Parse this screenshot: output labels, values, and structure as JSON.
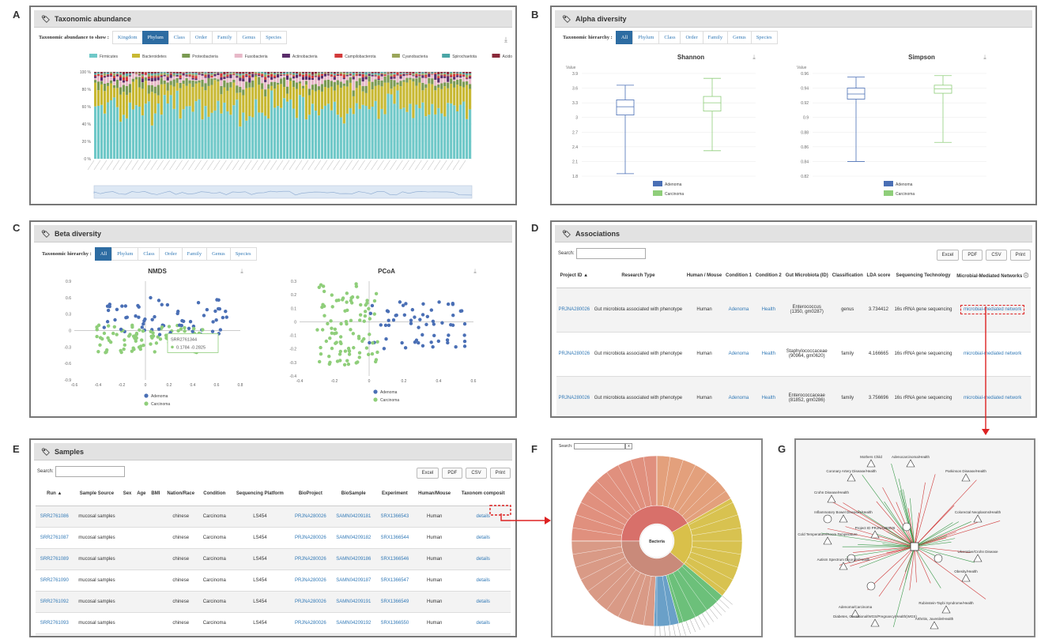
{
  "letters": [
    "A",
    "B",
    "C",
    "D",
    "E",
    "F",
    "G"
  ],
  "panelA": {
    "title": "Taxonomic abundance",
    "label": "Taxonomic abundance to show :",
    "tabs": [
      "Kingdom",
      "Phylum",
      "Class",
      "Order",
      "Family",
      "Genus",
      "Species"
    ],
    "legend": [
      "Firmicutes",
      "Bacteroidetes",
      "Proteobacteria",
      "Fusobacteria",
      "Actinobacteria",
      "Campilobacterota",
      "Cyanobacteria",
      "Spirochaetota",
      "Acido"
    ],
    "legend_colors": [
      "#6fc8c8",
      "#c8b832",
      "#7a9a52",
      "#e7b8c8",
      "#5a2d6a",
      "#d23a3a",
      "#9aa65a",
      "#4aa6a6",
      "#8a2a3a"
    ],
    "pager": "1/2",
    "yticks": [
      "100 %",
      "80 %",
      "60 %",
      "40 %",
      "20 %",
      "0 %"
    ]
  },
  "panelB": {
    "title": "Alpha diversity",
    "label": "Taxonomic hierarchy :",
    "tabs": [
      "All",
      "Phylum",
      "Class",
      "Order",
      "Family",
      "Genus",
      "Species"
    ],
    "charts": [
      {
        "title": "Shannon",
        "axis": "Value",
        "yticks": [
          "3.9",
          "3.6",
          "3.3",
          "3",
          "2.7",
          "2.4",
          "2.1",
          "1.8"
        ],
        "boxes": [
          {
            "name": "Adenoma",
            "min": 1.85,
            "q1": 3.05,
            "median": 3.22,
            "q3": 3.36,
            "max": 3.66,
            "color": "#4a6fb5"
          },
          {
            "name": "Carcinoma",
            "min": 2.32,
            "q1": 3.13,
            "median": 3.3,
            "q3": 3.43,
            "max": 3.8,
            "color": "#8fce7a"
          }
        ]
      },
      {
        "title": "Simpson",
        "axis": "Value",
        "yticks": [
          "0.96",
          "0.94",
          "0.92",
          "0.9",
          "0.88",
          "0.86",
          "0.84",
          "0.82"
        ],
        "boxes": [
          {
            "name": "Adenoma",
            "min": 0.84,
            "q1": 0.925,
            "median": 0.932,
            "q3": 0.94,
            "max": 0.955,
            "color": "#4a6fb5"
          },
          {
            "name": "Carcinoma",
            "min": 0.866,
            "q1": 0.933,
            "median": 0.939,
            "q3": 0.944,
            "max": 0.957,
            "color": "#8fce7a"
          }
        ]
      }
    ],
    "legend": [
      "Adenoma",
      "Carcinoma"
    ]
  },
  "panelC": {
    "title": "Beta diversity",
    "label": "Taxonomic hierarchy :",
    "tabs": [
      "All",
      "Phylum",
      "Class",
      "Order",
      "Family",
      "Genus",
      "Species"
    ],
    "nmds_title": "NMDS",
    "pcoa_title": "PCoA",
    "nmds_xticks": [
      "-0.6",
      "-0.4",
      "-0.2",
      "0",
      "0.2",
      "0.4",
      "0.6",
      "0.8"
    ],
    "nmds_yticks": [
      "0.9",
      "0.6",
      "0.3",
      "0",
      "-0.3",
      "-0.6",
      "-0.9"
    ],
    "pcoa_xticks": [
      "-0.4",
      "-0.2",
      "0",
      "0.2",
      "0.4",
      "0.6"
    ],
    "pcoa_yticks": [
      "0.3",
      "0.2",
      "0.1",
      "0",
      "-0.1",
      "-0.2",
      "-0.3",
      "-0.4"
    ],
    "tooltip_id": "SRR2761344",
    "tooltip_vals": "0.1784  -0.2825",
    "legend": [
      "Adenoma",
      "Carcinoma"
    ]
  },
  "panelD": {
    "title": "Associations",
    "search": "Search:",
    "buttons": [
      "Excel",
      "PDF",
      "CSV",
      "Print"
    ],
    "headers": [
      "Project ID",
      "Research Type",
      "Human / Mouse",
      "Condition 1",
      "Condition 2",
      "Gut Microbiota (ID)",
      "Classification",
      "LDA score",
      "Sequencing Technology",
      "Microbial-Mediated Networks"
    ],
    "rows": [
      {
        "project": "PRJNA280026",
        "type": "Gut microbiota associated with phenotype",
        "host": "Human",
        "c1": "Adenoma",
        "c2": "Health",
        "micro": "Enterococcus",
        "micro_id": "(1350, gm0287)",
        "cls": "genus",
        "lda": "3.734412",
        "seq": "16s rRNA gene sequencing",
        "net": "microbial-mediated network"
      },
      {
        "project": "PRJNA280026",
        "type": "Gut microbiota associated with phenotype",
        "host": "Human",
        "c1": "Adenoma",
        "c2": "Health",
        "micro": "Staphylococcaceae",
        "micro_id": "(90964, gm0620)",
        "cls": "family",
        "lda": "4.166665",
        "seq": "16s rRNA gene sequencing",
        "net": "microbial-mediated network"
      },
      {
        "project": "PRJNA280026",
        "type": "Gut microbiota associated with phenotype",
        "host": "Human",
        "c1": "Adenoma",
        "c2": "Health",
        "micro": "Enterococcaceae",
        "micro_id": "(81852, gm0286)",
        "cls": "family",
        "lda": "3.756696",
        "seq": "16s rRNA gene sequencing",
        "net": "microbial-mediated network"
      }
    ]
  },
  "panelE": {
    "title": "Samples",
    "search": "Search:",
    "buttons": [
      "Excel",
      "PDF",
      "CSV",
      "Print"
    ],
    "headers": [
      "Run",
      "Sample Source",
      "Sex",
      "Age",
      "BMI",
      "Nation/Race",
      "Condition",
      "Sequencing Platform",
      "BioProject",
      "BioSample",
      "Experiment",
      "Human/Mouse",
      "Taxonom composit"
    ],
    "rows": [
      {
        "run": "SRR2761086",
        "src": "mucosal samples",
        "nation": "chinese",
        "cond": "Carcinoma",
        "plat": "LS454",
        "bp": "PRJNA280026",
        "bs": "SAMN04209181",
        "exp": "SRX1366543",
        "host": "Human",
        "d": "details"
      },
      {
        "run": "SRR2761087",
        "src": "mucosal samples",
        "nation": "chinese",
        "cond": "Carcinoma",
        "plat": "LS454",
        "bp": "PRJNA280026",
        "bs": "SAMN04209182",
        "exp": "SRX1366544",
        "host": "Human",
        "d": "details"
      },
      {
        "run": "SRR2761089",
        "src": "mucosal samples",
        "nation": "chinese",
        "cond": "Carcinoma",
        "plat": "LS454",
        "bp": "PRJNA280026",
        "bs": "SAMN04209186",
        "exp": "SRX1366546",
        "host": "Human",
        "d": "details"
      },
      {
        "run": "SRR2761090",
        "src": "mucosal samples",
        "nation": "chinese",
        "cond": "Carcinoma",
        "plat": "LS454",
        "bp": "PRJNA280026",
        "bs": "SAMN04209187",
        "exp": "SRX1366547",
        "host": "Human",
        "d": "details"
      },
      {
        "run": "SRR2761092",
        "src": "mucosal samples",
        "nation": "chinese",
        "cond": "Carcinoma",
        "plat": "LS454",
        "bp": "PRJNA280026",
        "bs": "SAMN04209191",
        "exp": "SRX1366549",
        "host": "Human",
        "d": "details"
      },
      {
        "run": "SRR2761093",
        "src": "mucosal samples",
        "nation": "chinese",
        "cond": "Carcinoma",
        "plat": "LS454",
        "bp": "PRJNA280026",
        "bs": "SAMN04209192",
        "exp": "SRX1366550",
        "host": "Human",
        "d": "details"
      },
      {
        "run": "SRR2761096",
        "src": "mucosal",
        "nation": "chinese",
        "cond": "Carcinoma",
        "plat": "LS454",
        "bp": "PRJNA280026",
        "bs": "SAMN04208932",
        "exp": "SRX1366553",
        "host": "Human",
        "d": "details"
      }
    ]
  },
  "panelF": {
    "search": "Search:",
    "center": "Bacteria",
    "x": "x"
  },
  "panelG": {
    "nodes": [
      "Mothers Child",
      "Adenocarcinoma/Health",
      "Coronary Artery Disease/Health",
      "Parkinson Disease/Health",
      "Crohn Disease/Health",
      "Inflammatory Bowel Diseases/Health",
      "Cold Temperature/Room Temperature",
      "Autism Spectrum Disorder/Health",
      "Ulcerative/Crohn Disease",
      "Obesity/Health",
      "Adenoma/Carcinoma",
      "Diabetes, Gestational/WGS/Pregnancy/Health(WGS)",
      "Arthritis, Juvenile/Health",
      "Rubinstein-Taybi Syndrome/Health",
      "Project ID PRJNA280026",
      "Colorectal Neoplasms/Health"
    ]
  }
}
